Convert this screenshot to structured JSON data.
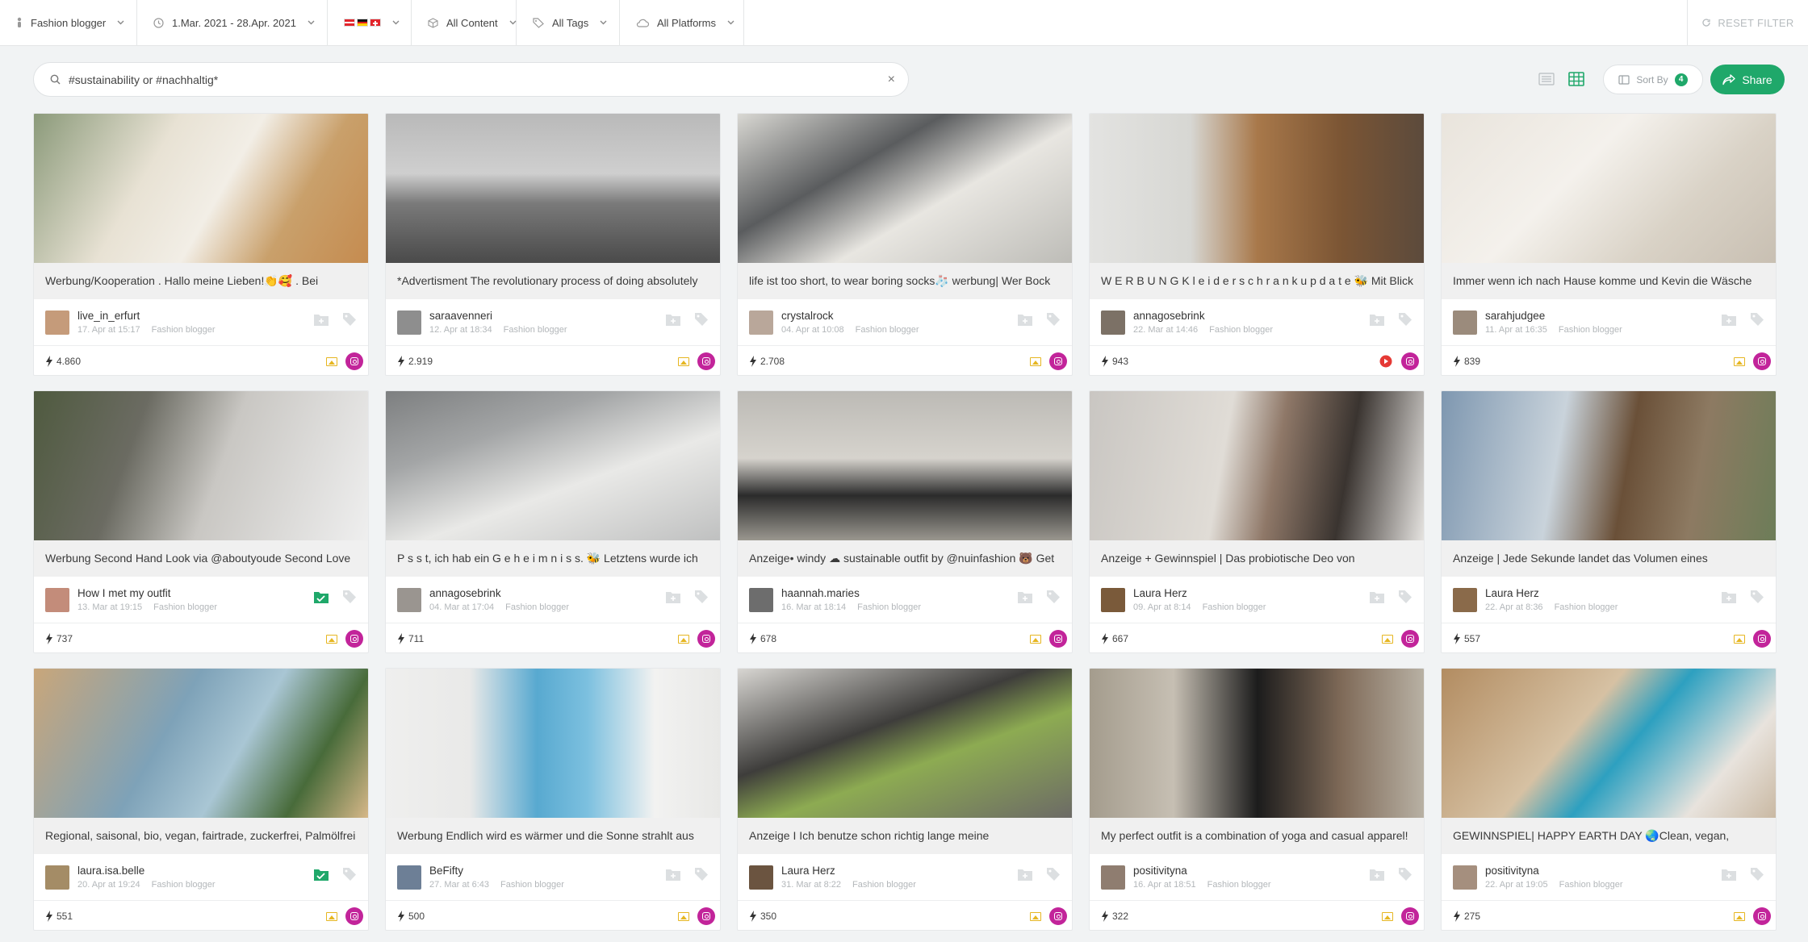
{
  "filters": {
    "group": "Fashion blogger",
    "date_range": "1.Mar. 2021 - 28.Apr. 2021",
    "content": "All Content",
    "tags": "All Tags",
    "platforms": "All Platforms",
    "reset": "RESET FILTER"
  },
  "search": {
    "value": "#sustainability or #nachhaltig*"
  },
  "toolbar": {
    "sort_label": "Sort By",
    "sort_count": "4",
    "share_label": "Share"
  },
  "colors": {
    "accent": "#1fa86a",
    "instagram": "#c2249a",
    "youtube": "#e53935",
    "image_badge": "#e6b621"
  },
  "posts": [
    {
      "caption": "Werbung/Kooperation . Hallo meine Lieben!👏🥰 . Bei",
      "author": "live_in_erfurt",
      "date": "17. Apr at 15:17",
      "category": "Fashion blogger",
      "reach": "4.860",
      "platform": "instagram"
    },
    {
      "caption": "*Advertisment The revolutionary process of doing absolutely",
      "author": "saraavenneri",
      "date": "12. Apr at 18:34",
      "category": "Fashion blogger",
      "reach": "2.919",
      "platform": "instagram"
    },
    {
      "caption": "life ist too short, to wear boring socks🧦 werbung| Wer Bock",
      "author": "crystalrock",
      "date": "04. Apr at 10:08",
      "category": "Fashion blogger",
      "reach": "2.708",
      "platform": "instagram"
    },
    {
      "caption": "W E R B U N G K l e i d e r s c h r a n k u p d a t e 🐝 Mit Blick",
      "author": "annagosebrink",
      "date": "22. Mar at 14:46",
      "category": "Fashion blogger",
      "reach": "943",
      "platform": "instagram",
      "youtube": true
    },
    {
      "caption": "Immer wenn ich nach Hause komme und Kevin die Wäsche",
      "author": "sarahjudgee",
      "date": "11. Apr at 16:35",
      "category": "Fashion blogger",
      "reach": "839",
      "platform": "instagram"
    },
    {
      "caption": "Werbung Second Hand Look via @aboutyoude Second Love",
      "author": "How I met my outfit",
      "date": "13. Mar at 19:15",
      "category": "Fashion blogger",
      "reach": "737",
      "platform": "instagram",
      "saved": true
    },
    {
      "caption": "P s s t, ich hab ein G e h e i m n i s s. 🐝 Letztens wurde ich",
      "author": "annagosebrink",
      "date": "04. Mar at 17:04",
      "category": "Fashion blogger",
      "reach": "711",
      "platform": "instagram"
    },
    {
      "caption": "Anzeige• windy ☁ sustainable outfit by @nuinfashion 🐻 Get",
      "author": "haannah.maries",
      "date": "16. Mar at 18:14",
      "category": "Fashion blogger",
      "reach": "678",
      "platform": "instagram"
    },
    {
      "caption": "Anzeige + Gewinnspiel | Das probiotische Deo von",
      "author": "Laura Herz",
      "date": "09. Apr at 8:14",
      "category": "Fashion blogger",
      "reach": "667",
      "platform": "instagram"
    },
    {
      "caption": "Anzeige | Jede Sekunde landet das Volumen eines",
      "author": "Laura Herz",
      "date": "22. Apr at 8:36",
      "category": "Fashion blogger",
      "reach": "557",
      "platform": "instagram"
    },
    {
      "caption": "Regional, saisonal, bio, vegan, fairtrade, zuckerfrei, Palmölfrei",
      "author": "laura.isa.belle",
      "date": "20. Apr at 19:24",
      "category": "Fashion blogger",
      "reach": "551",
      "platform": "instagram",
      "saved": true
    },
    {
      "caption": "Werbung Endlich wird es wärmer und die Sonne strahlt aus",
      "author": "BeFifty",
      "date": "27. Mar at 6:43",
      "category": "Fashion blogger",
      "reach": "500",
      "platform": "instagram"
    },
    {
      "caption": "Anzeige I Ich benutze schon richtig lange meine",
      "author": "Laura Herz",
      "date": "31. Mar at 8:22",
      "category": "Fashion blogger",
      "reach": "350",
      "platform": "instagram"
    },
    {
      "caption": "My perfect outfit is a combination of yoga and casual apparel!",
      "author": "positivityna",
      "date": "16. Apr at 18:51",
      "category": "Fashion blogger",
      "reach": "322",
      "platform": "instagram"
    },
    {
      "caption": "GEWINNSPIEL| HAPPY EARTH DAY 🌏Clean, vegan,",
      "author": "positivityna",
      "date": "22. Apr at 19:05",
      "category": "Fashion blogger",
      "reach": "275",
      "platform": "instagram"
    }
  ]
}
